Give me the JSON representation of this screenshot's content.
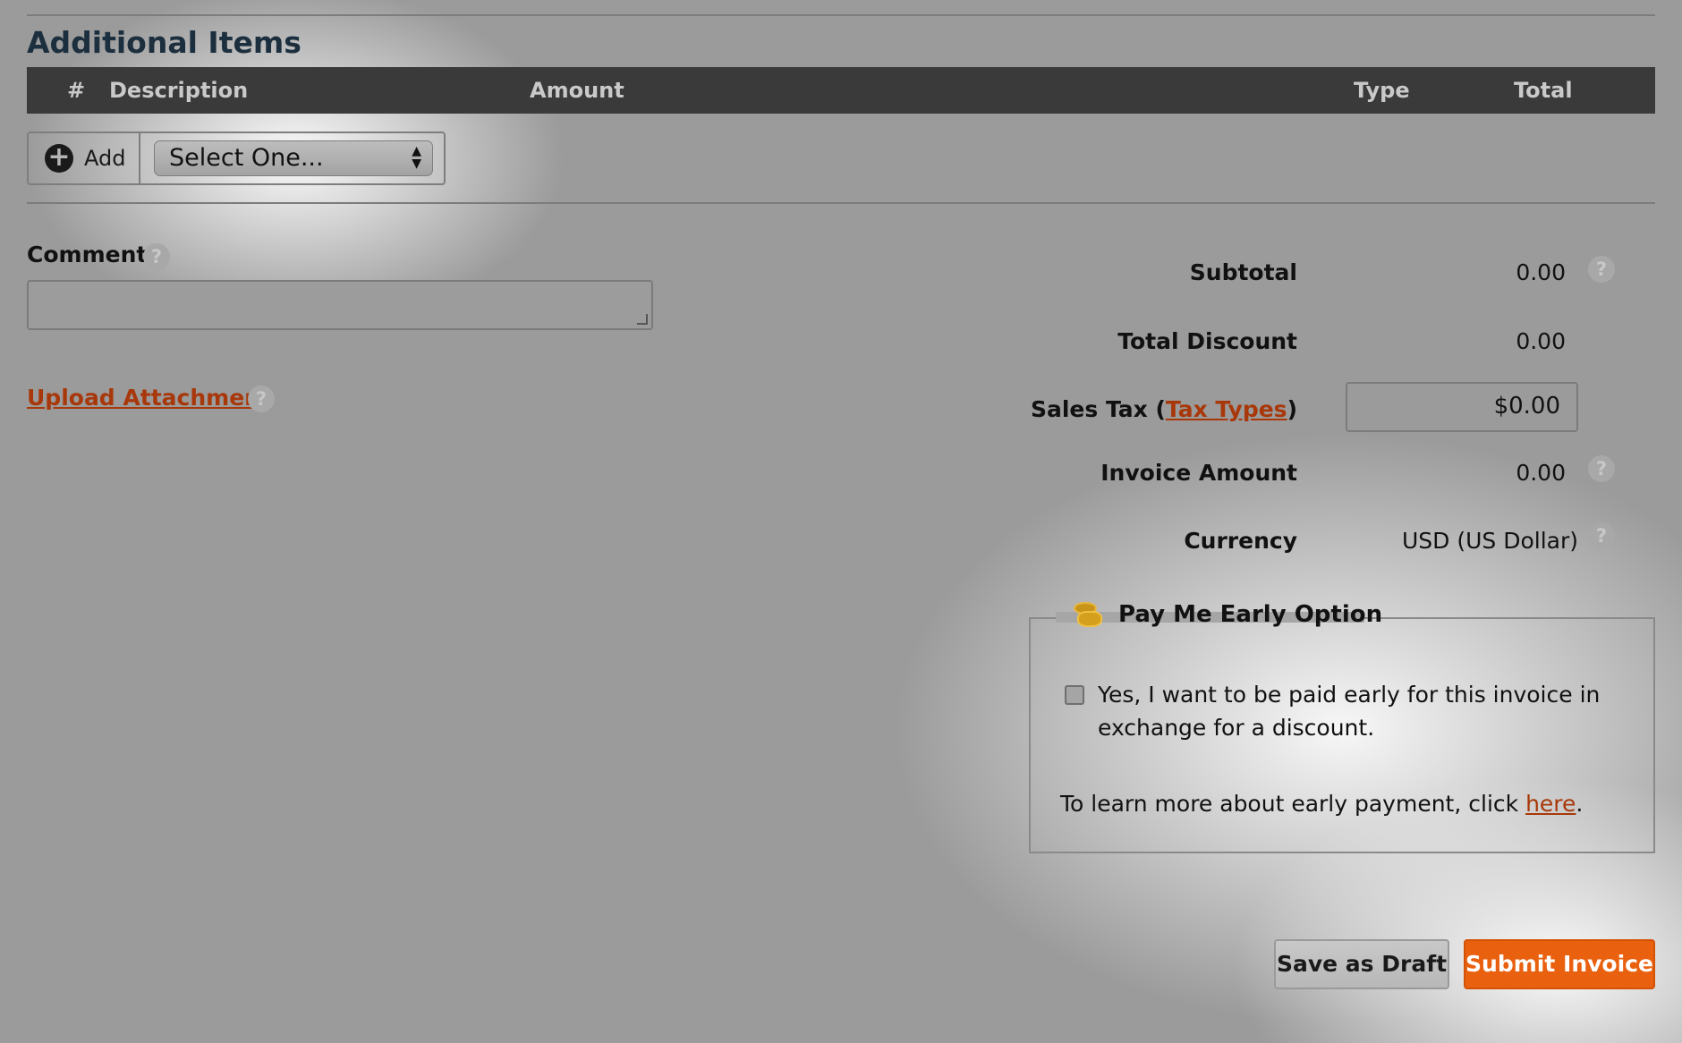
{
  "section_title": "Additional Items",
  "table": {
    "columns": [
      "#",
      "Description",
      "Amount",
      "Type",
      "Total"
    ]
  },
  "add_bar": {
    "add_label": "Add",
    "select_value": "Select One..."
  },
  "comment": {
    "label": "Comment",
    "value": ""
  },
  "upload_label": "Upload Attachment",
  "summary": {
    "subtotal_label": "Subtotal",
    "subtotal_value": "0.00",
    "discount_label": "Total Discount",
    "discount_value": "0.00",
    "tax_label_prefix": "Sales Tax (",
    "tax_link": "Tax Types",
    "tax_label_suffix": ")",
    "tax_value": "$0.00",
    "invoice_label": "Invoice Amount",
    "invoice_value": "0.00",
    "currency_label": "Currency",
    "currency_value": "USD (US Dollar)"
  },
  "pay_early": {
    "title": "Pay Me Early Option",
    "checkbox_text": "Yes, I want to be paid early for this invoice in exchange for a discount.",
    "checked": false,
    "learn_prefix": "To learn more about early payment, click ",
    "learn_link": "here",
    "learn_suffix": "."
  },
  "buttons": {
    "draft": "Save as Draft",
    "submit": "Submit Invoice"
  },
  "help_glyph": "?",
  "colors": {
    "header_bg": "#3a3a3a",
    "link": "#a8380a",
    "submit": "#e9600f"
  }
}
